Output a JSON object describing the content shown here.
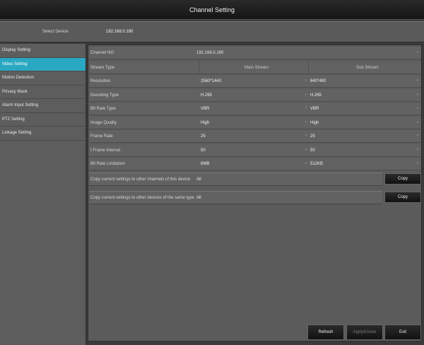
{
  "window": {
    "title": "Channel Setting"
  },
  "device": {
    "label": "Select Device",
    "value": "192.168.0.180"
  },
  "sidebar": {
    "items": [
      {
        "label": "Display Setting"
      },
      {
        "label": "Video Setting"
      },
      {
        "label": "Motion Detection"
      },
      {
        "label": "Privacy Mask"
      },
      {
        "label": "Alarm Input Setting"
      },
      {
        "label": "PTZ Setting"
      },
      {
        "label": "Linkage Setting"
      }
    ],
    "active_index": 1
  },
  "video": {
    "channel_label": "Channel NO",
    "channel_value": "192.168.0.180",
    "stream_type_label": "Stream Type",
    "main_stream_label": "Main Stream",
    "sub_stream_label": "Sub Stream",
    "rows": [
      {
        "label": "Resolution",
        "main": "2560*1440",
        "sub": "640*480"
      },
      {
        "label": "Decoding Type",
        "main": "H.265",
        "sub": "H.265"
      },
      {
        "label": "Bit Rate Type",
        "main": "VBR",
        "sub": "VBR"
      },
      {
        "label": "Image Quality",
        "main": "High",
        "sub": "High"
      },
      {
        "label": "Frame Rate",
        "main": "25",
        "sub": "25"
      },
      {
        "label": "I Frame Interval",
        "main": "50",
        "sub": "50"
      },
      {
        "label": "Bit Rate Limitation",
        "main": "6MB",
        "sub": "512KB"
      }
    ]
  },
  "copy": {
    "channels_label": "Copy current settings to other channels of this device",
    "channels_value": "All",
    "devices_label": "Copy current settings to other devices of the same type",
    "devices_value": "All",
    "button_label": "Copy"
  },
  "footer": {
    "refresh": "Refresh",
    "apply": "Apply&Save",
    "exit": "Exit"
  },
  "colors": {
    "accent": "#2aa8c2"
  }
}
